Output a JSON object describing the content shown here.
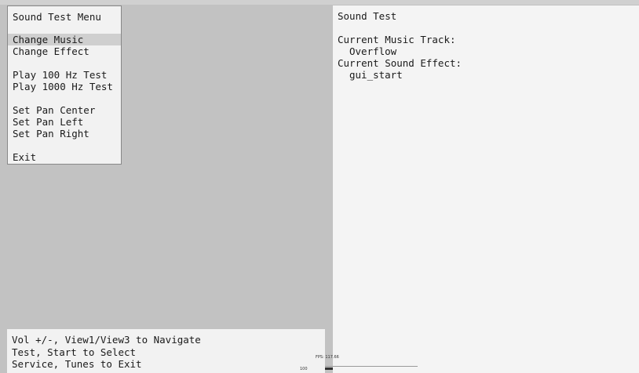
{
  "menu": {
    "title": "Sound Test Menu",
    "items": [
      {
        "label": "Change Music",
        "selected": true
      },
      {
        "label": "Change Effect",
        "selected": false
      },
      {
        "label": "Play 100 Hz Test",
        "selected": false
      },
      {
        "label": "Play 1000 Hz Test",
        "selected": false
      },
      {
        "label": "Set Pan Center",
        "selected": false
      },
      {
        "label": "Set Pan Left",
        "selected": false
      },
      {
        "label": "Set Pan Right",
        "selected": false
      },
      {
        "label": "Exit",
        "selected": false
      }
    ]
  },
  "info": {
    "title": "Sound Test",
    "music_label": "Current Music Track:",
    "music_value": "Overflow",
    "effect_label": "Current Sound Effect:",
    "effect_value": "gui_start"
  },
  "help": {
    "lines": [
      "Vol +/-, View1/View3 to Navigate",
      "Test, Start to Select",
      "Service, Tunes to Exit"
    ]
  },
  "fps": {
    "label": "FPS: 117.66",
    "scale": "100"
  },
  "colors": {
    "background": "#c2c2c2",
    "panel": "#f2f2f2",
    "selection": "#cfcfcf"
  }
}
